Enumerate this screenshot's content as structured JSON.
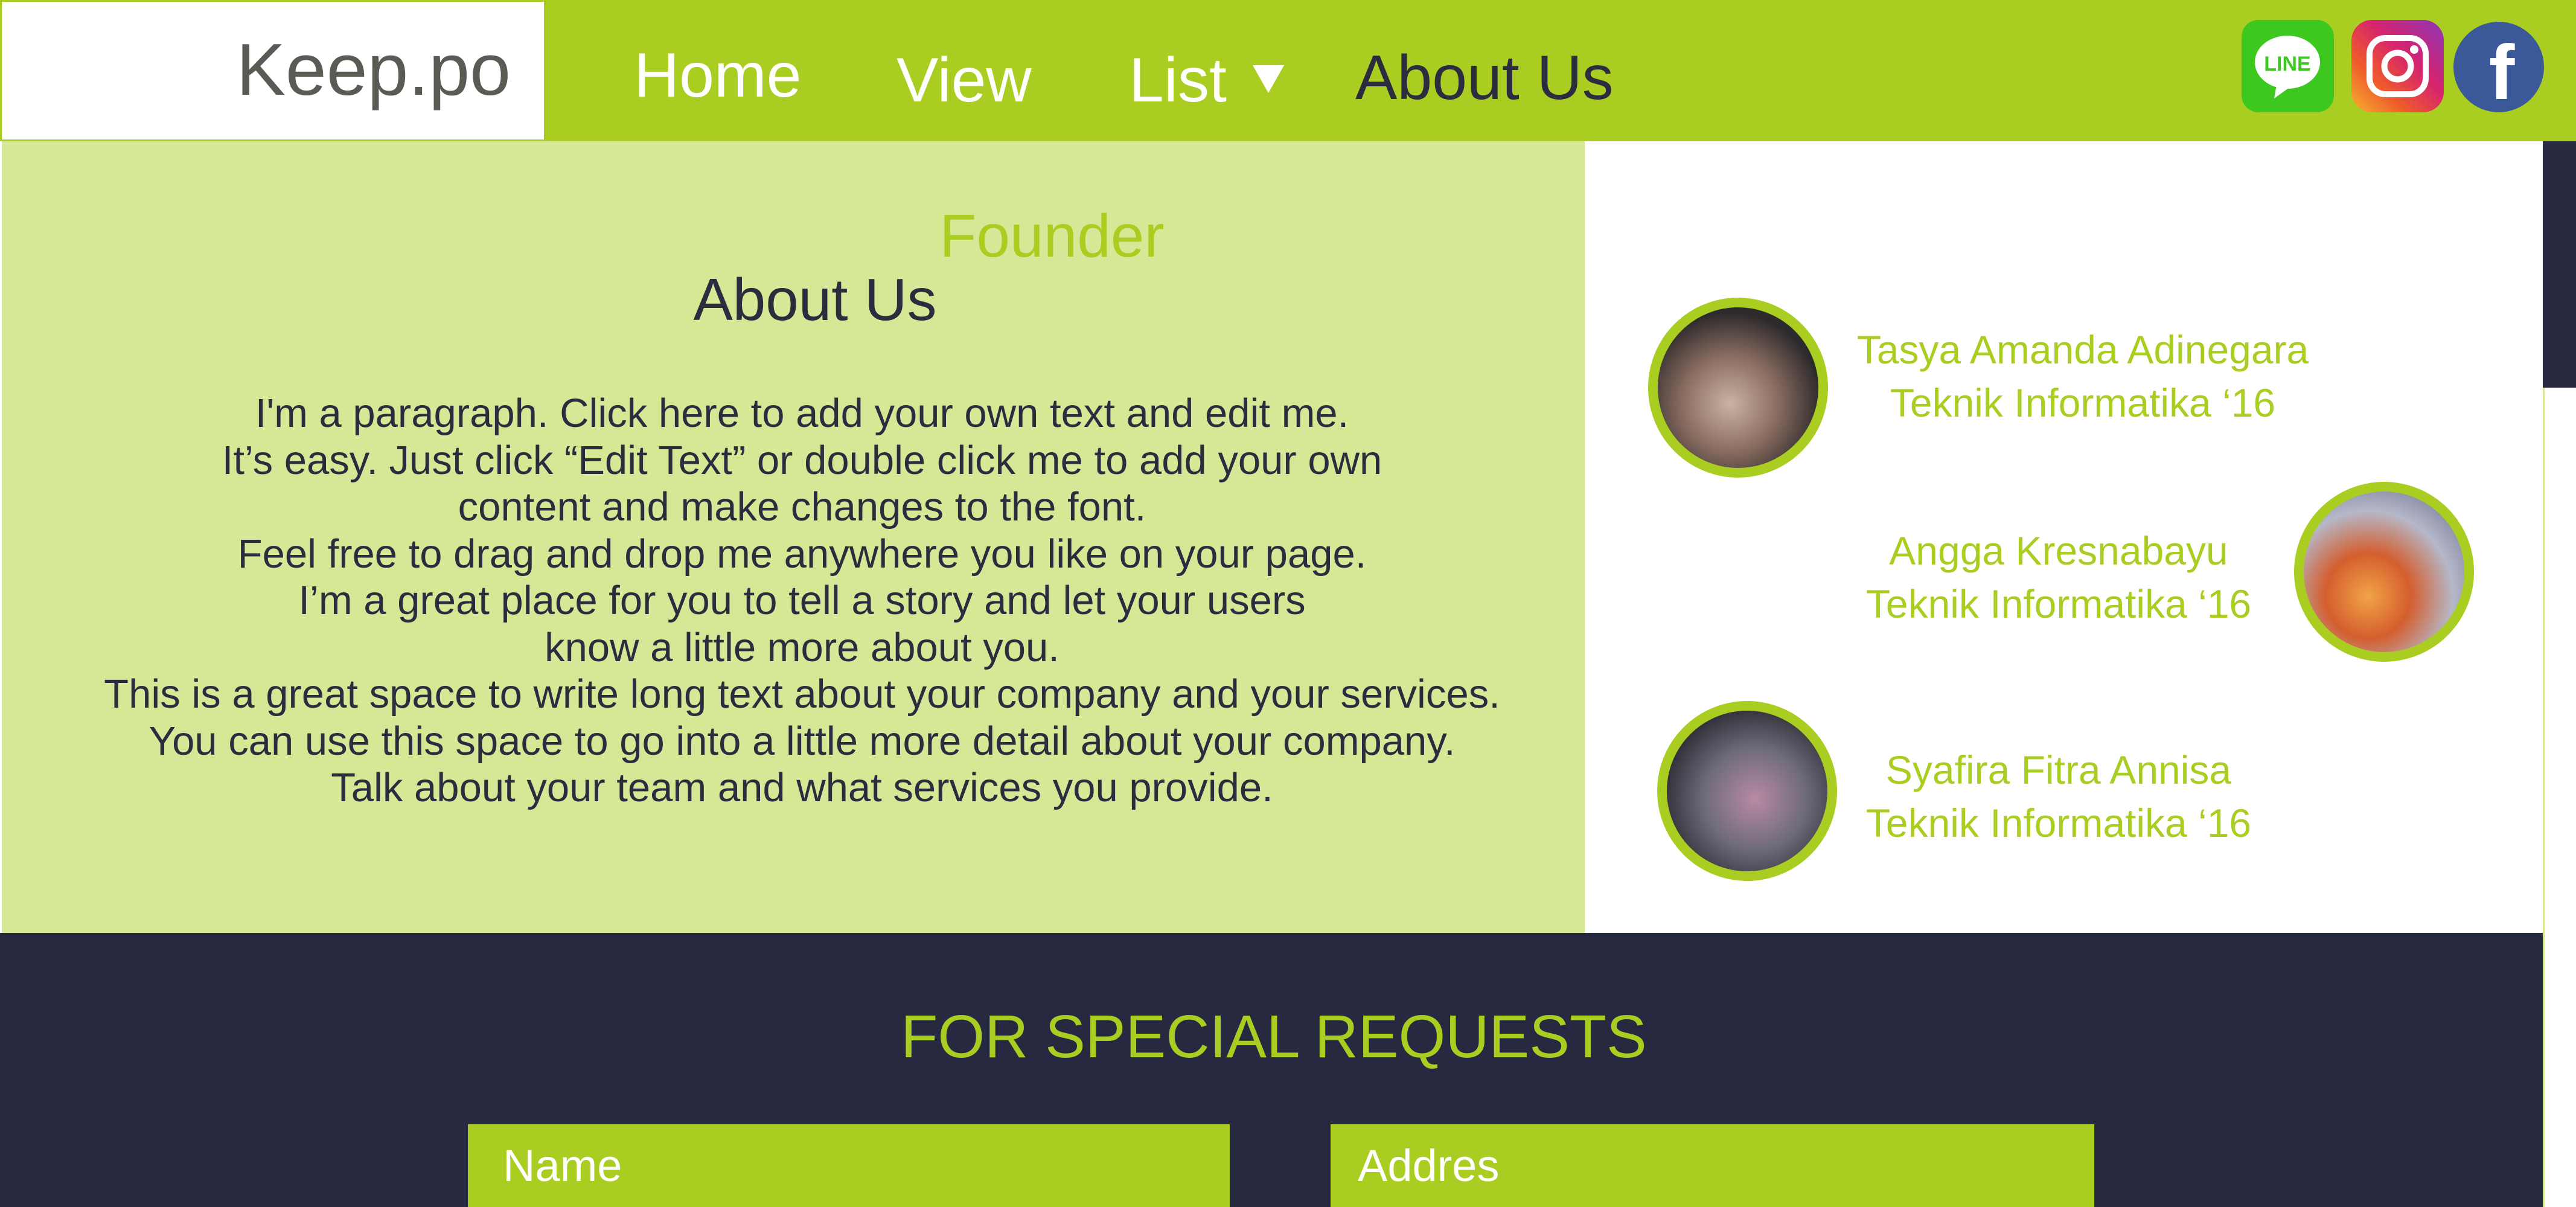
{
  "header": {
    "logo": "Keep.po",
    "nav": {
      "home": "Home",
      "view": "View",
      "list": "List",
      "about": "About Us"
    },
    "social": {
      "line_label": "LINE",
      "instagram": "instagram-icon",
      "facebook_label": "f"
    }
  },
  "about": {
    "title": "About Us",
    "lines": [
      "I'm a paragraph. Click here to add your own text and edit me.",
      "It’s easy. Just click “Edit Text” or double click me to add your own",
      "content and make changes to the font.",
      "Feel free to drag and drop me anywhere you like on your page.",
      "I’m a great place for you to tell a story and let your users",
      "know a little more about you.",
      "This is a great space to write long text about your company and your services.",
      "You can use this space to go into a little more detail about your company.",
      "Talk about your team and what services you provide."
    ]
  },
  "founder": {
    "title": "Founder",
    "people": [
      {
        "name": "Tasya Amanda Adinegara",
        "role": "Teknik Informatika ‘16"
      },
      {
        "name": "Angga Kresnabayu",
        "role": "Teknik Informatika ‘16"
      },
      {
        "name": "Syafira Fitra Annisa",
        "role": "Teknik Informatika ‘16"
      }
    ]
  },
  "requests": {
    "title": "FOR SPECIAL REQUESTS",
    "name_placeholder": "Name",
    "address_placeholder": "Addres"
  },
  "colors": {
    "accent": "#aacd22",
    "dark": "#262940",
    "light_green": "#d6e896"
  }
}
